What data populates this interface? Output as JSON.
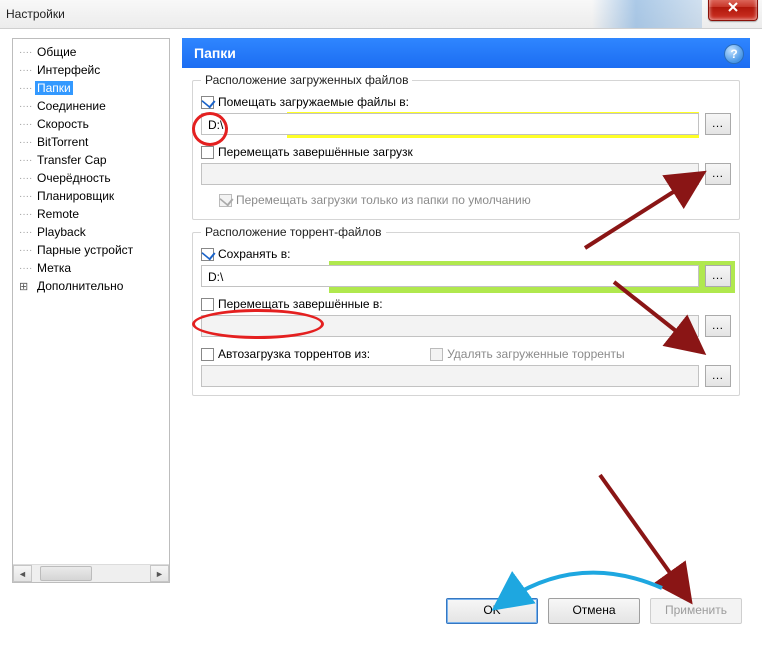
{
  "window": {
    "title": "Настройки"
  },
  "sidebar": {
    "items": [
      {
        "label": "Общие"
      },
      {
        "label": "Интерфейс"
      },
      {
        "label": "Папки"
      },
      {
        "label": "Соединение"
      },
      {
        "label": "Скорость"
      },
      {
        "label": "BitTorrent"
      },
      {
        "label": "Transfer Cap"
      },
      {
        "label": "Очерёдность"
      },
      {
        "label": "Планировщик"
      },
      {
        "label": "Remote"
      },
      {
        "label": "Playback"
      },
      {
        "label": "Парные устройст"
      },
      {
        "label": "Метка"
      }
    ],
    "extra": {
      "label": "Дополнительно"
    },
    "selected_index": 2
  },
  "panel": {
    "title": "Папки",
    "help": "?"
  },
  "groups": {
    "downloads": {
      "title": "Расположение загруженных файлов",
      "put_new": {
        "label": "Помещать загружаемые файлы в:",
        "checked": true,
        "path": "D:\\"
      },
      "move_completed": {
        "label": "Перемещать завершённые загрузк",
        "checked": false,
        "path": ""
      },
      "move_only_default": {
        "label": "Перемещать загрузки только из папки по умолчанию",
        "checked": true,
        "disabled": true
      }
    },
    "torrents": {
      "title": "Расположение торрент-файлов",
      "store_in": {
        "label": "Сохранять в:",
        "checked": true,
        "path": "D:\\"
      },
      "move_completed": {
        "label": "Перемещать завершённые в:",
        "checked": false,
        "path": ""
      },
      "autoload": {
        "label": "Автозагрузка торрентов из:",
        "checked": false,
        "path": ""
      },
      "delete_loaded": {
        "label": "Удалять загруженные торренты",
        "checked": false,
        "disabled": true
      }
    }
  },
  "buttons": {
    "ok": "OK",
    "cancel": "Отмена",
    "apply": "Применить"
  },
  "browse_glyph": "…"
}
